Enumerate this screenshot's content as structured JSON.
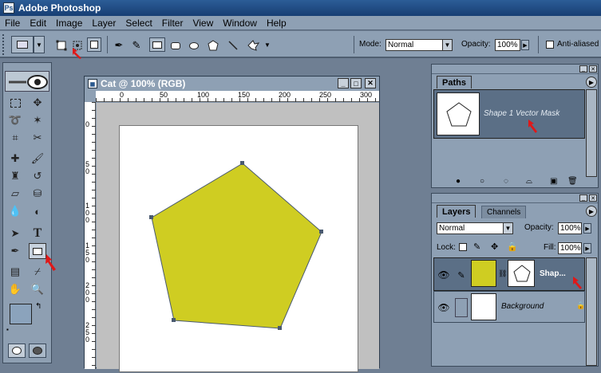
{
  "app": {
    "title": "Adobe Photoshop"
  },
  "menu": [
    "File",
    "Edit",
    "Image",
    "Layer",
    "Select",
    "Filter",
    "View",
    "Window",
    "Help"
  ],
  "options": {
    "mode_label": "Mode:",
    "mode_value": "Normal",
    "opacity_label": "Opacity:",
    "opacity_value": "100%",
    "antialiased_label": "Anti-aliased"
  },
  "document": {
    "title": "Cat @ 100% (RGB)",
    "ruler_top": [
      "0",
      "50",
      "100",
      "150",
      "200",
      "250",
      "300"
    ],
    "ruler_left": [
      "0",
      "50",
      "100",
      "150",
      "200",
      "250"
    ]
  },
  "paths_panel": {
    "tab": "Paths",
    "item_label": "Shape 1 Vector Mask"
  },
  "layers_panel": {
    "tabs": [
      "Layers",
      "Channels"
    ],
    "blend_mode": "Normal",
    "opacity_label": "Opacity:",
    "opacity_value": "100%",
    "lock_label": "Lock:",
    "fill_label": "Fill:",
    "fill_value": "100%",
    "layers": [
      {
        "name": "Shap...",
        "selected": true
      },
      {
        "name": "Background",
        "selected": false
      }
    ]
  },
  "colors": {
    "shape_fill": "#cfcd22",
    "foreground": "#8ba3bc",
    "accent_arrow": "#e01818",
    "titlebar": "#234c82"
  }
}
